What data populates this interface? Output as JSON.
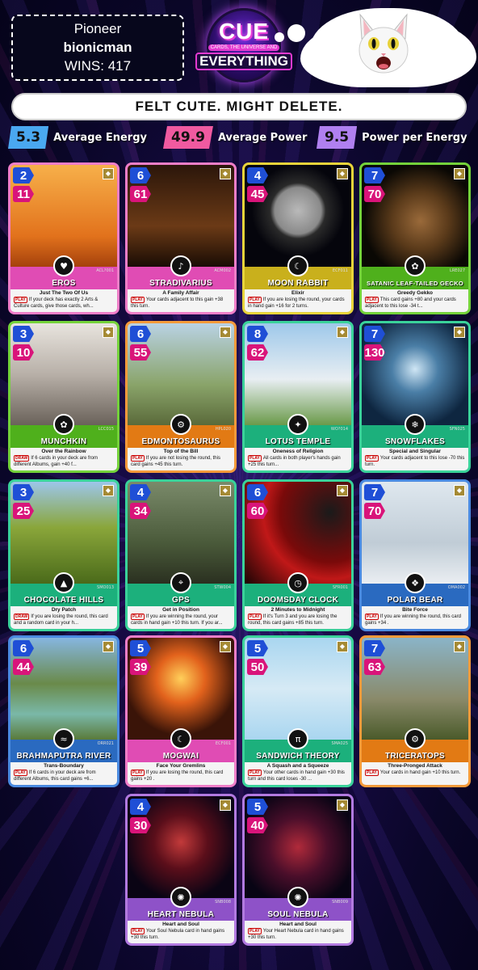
{
  "profile": {
    "rank": "Pioneer",
    "name": "bionicman",
    "wins": "WINS: 417"
  },
  "logo": {
    "line1": "CUE",
    "tagline": "CARDS, THE UNIVERSE AND",
    "line2": "EVERYTHING"
  },
  "slogan": "FELT CUTE. MIGHT DELETE.",
  "stats": [
    {
      "value": "5.3",
      "label": "Average Energy",
      "color": "#4aa8f0"
    },
    {
      "value": "49.9",
      "label": "Average Power",
      "color": "#f05aa0"
    },
    {
      "value": "9.5",
      "label": "Power per Energy",
      "color": "#b080f0"
    }
  ],
  "cards": [
    {
      "energy": "2",
      "power": "11",
      "name": "EROS",
      "ability": "Just The Two Of Us",
      "trigger": "PLAY",
      "text": "If your deck has exactly 2 Arts & Culture cards, give those cards, wh...",
      "code": "ACL?001",
      "frame": "#f07ec8",
      "band": "#e04cb4",
      "emblem": "♥"
    },
    {
      "energy": "6",
      "power": "61",
      "name": "STRADIVARIUS",
      "ability": "A Family Affair",
      "trigger": "PLAY",
      "text": "Your cards adjacent to this gain +38 this turn.",
      "code": "ACM002",
      "frame": "#f07ec8",
      "band": "#e04cb4",
      "emblem": "♪"
    },
    {
      "energy": "4",
      "power": "45",
      "name": "MOON RABBIT",
      "ability": "Elixir",
      "trigger": "PLAY",
      "text": "If you are losing the round, your cards in hand gain +16 for 2 turns.",
      "code": "ECF011",
      "frame": "#e8d43a",
      "band": "#c9b01c",
      "emblem": "☾"
    },
    {
      "energy": "7",
      "power": "70",
      "name": "SATANIC LEAF-TAILED GECKO",
      "ability": "Greedy Gekko",
      "trigger": "PLAY",
      "text": "This card gains +80 and your cards adjacent to this lose -34 t...",
      "code": "LRE027",
      "frame": "#74d23a",
      "band": "#4fb01c",
      "emblem": "✿"
    },
    {
      "energy": "3",
      "power": "10",
      "name": "MUNCHKIN",
      "ability": "Over the Rainbow",
      "trigger": "DRAW",
      "text": "If 6 cards in your deck are from different Albums, gain +40 f...",
      "code": "LCC015",
      "frame": "#74d23a",
      "band": "#4fb01c",
      "emblem": "✿"
    },
    {
      "energy": "6",
      "power": "55",
      "name": "EDMONTOSAURUS",
      "ability": "Top of the Bill",
      "trigger": "PLAY",
      "text": "If you are not losing the round, this card gains +45 this turn.",
      "code": "HPL020",
      "frame": "#f49a3a",
      "band": "#e27a14",
      "emblem": "⚙"
    },
    {
      "energy": "8",
      "power": "62",
      "name": "LOTUS TEMPLE",
      "ability": "Oneness of Religion",
      "trigger": "PLAY",
      "text": "All cards in both player's hands gain +25 this turn...",
      "code": "WO?014",
      "frame": "#3ad29a",
      "band": "#1cb07c",
      "emblem": "✦"
    },
    {
      "energy": "7",
      "power": "130",
      "name": "SNOWFLAKES",
      "ability": "Special and Singular",
      "trigger": "PLAY",
      "text": "Your cards adjacent to this lose -70 this turn.",
      "code": "SFN025",
      "frame": "#3ad29a",
      "band": "#1cb07c",
      "emblem": "❄"
    },
    {
      "energy": "3",
      "power": "25",
      "name": "CHOCOLATE HILLS",
      "ability": "Dry Patch",
      "trigger": "DRAW",
      "text": "If you are losing the round, this card and a random card in your h...",
      "code": "SMO013",
      "frame": "#3ad29a",
      "band": "#1cb07c",
      "emblem": "▲"
    },
    {
      "energy": "4",
      "power": "34",
      "name": "GPS",
      "ability": "Get in Position",
      "trigger": "PLAY",
      "text": "If you are winning the round, your cards in hand gain +10 this turn. If you ar...",
      "code": "STW004",
      "frame": "#3ad29a",
      "band": "#1cb07c",
      "emblem": "⌖"
    },
    {
      "energy": "6",
      "power": "60",
      "name": "DOOMSDAY CLOCK",
      "ability": "2 Minutes to Midnight",
      "trigger": "PLAY",
      "text": "If it's Turn 3 and you are losing the round, this card gains +85 this turn.",
      "code": "SFR001",
      "frame": "#3ad29a",
      "band": "#1cb07c",
      "emblem": "◷"
    },
    {
      "energy": "7",
      "power": "70",
      "name": "POLAR BEAR",
      "ability": "Bite Force",
      "trigger": "PLAY",
      "text": "If you are winning the round, this card gains +34 .",
      "code": "OMA002",
      "frame": "#4a8ae0",
      "band": "#2a6ac0",
      "emblem": "❖"
    },
    {
      "energy": "6",
      "power": "44",
      "name": "BRAHMAPUTRA RIVER",
      "ability": "Trans-Boundary",
      "trigger": "PLAY",
      "text": "If 6 cards in your deck are from different Albums, this card gains +6...",
      "code": "ORR021",
      "frame": "#4a8ae0",
      "band": "#2a6ac0",
      "emblem": "≈"
    },
    {
      "energy": "5",
      "power": "39",
      "name": "MOGWAI",
      "ability": "Face Your Gremlins",
      "trigger": "PLAY",
      "text": "If you are losing the round, this card gains +20 .",
      "code": "ECF001",
      "frame": "#f07ec8",
      "band": "#e04cb4",
      "emblem": "☾"
    },
    {
      "energy": "5",
      "power": "50",
      "name": "SANDWICH THEORY",
      "ability": "A Squash and a Squeeze",
      "trigger": "PLAY",
      "text": "Your other cards in hand gain +30 this turn and this card loses -30 ...",
      "code": "SMA025",
      "frame": "#3ad29a",
      "band": "#1cb07c",
      "emblem": "π"
    },
    {
      "energy": "7",
      "power": "63",
      "name": "TRICERATOPS",
      "ability": "Three-Pronged Attack",
      "trigger": "PLAY",
      "text": "Your cards in hand gain +10 this turn.",
      "code": "",
      "frame": "#f49a3a",
      "band": "#e27a14",
      "emblem": "⚙"
    },
    {
      "energy": "4",
      "power": "30",
      "name": "HEART NEBULA",
      "ability": "Heart and Soul",
      "trigger": "PLAY",
      "text": "Your Soul Nebula card in hand gains +30 this turn.",
      "code": "SNB008",
      "frame": "#b27ae0",
      "band": "#8e52c8",
      "emblem": "✺"
    },
    {
      "energy": "5",
      "power": "40",
      "name": "SOUL NEBULA",
      "ability": "Heart and Soul",
      "trigger": "PLAY",
      "text": "Your Heart Nebula card in hand gains +30 this turn.",
      "code": "SNB009",
      "frame": "#b27ae0",
      "band": "#8e52c8",
      "emblem": "✺"
    }
  ]
}
